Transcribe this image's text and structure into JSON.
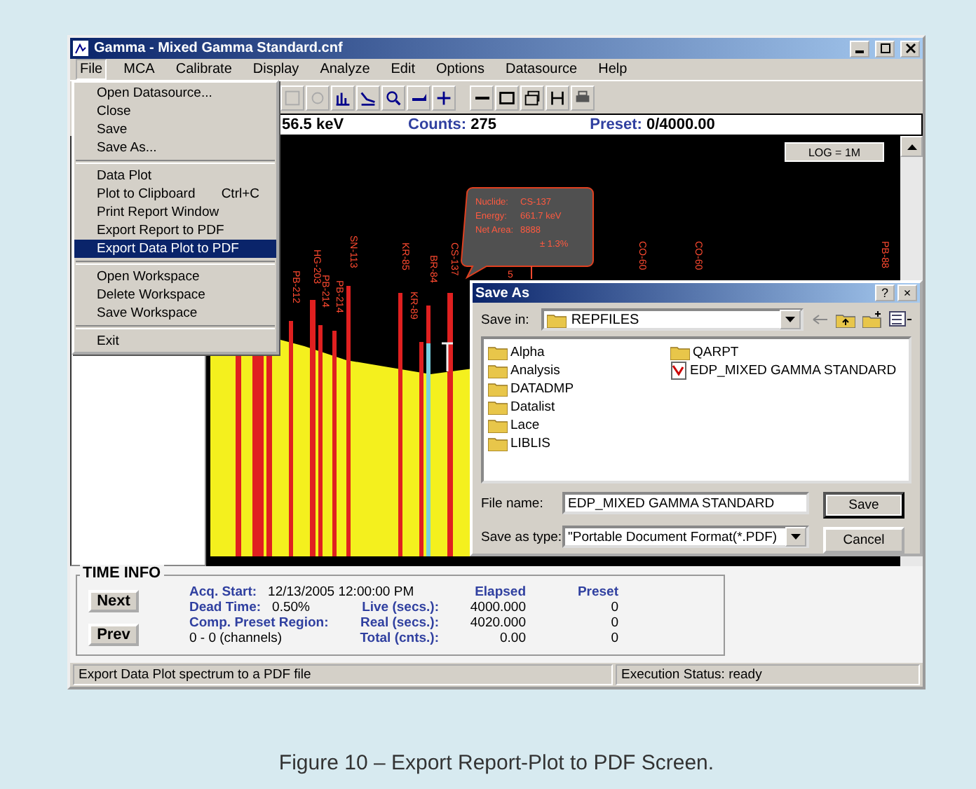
{
  "window": {
    "title": "Gamma - Mixed Gamma Standard.cnf"
  },
  "menu_bar": [
    {
      "label": "File",
      "selected": true
    },
    {
      "label": "MCA",
      "selected": false
    },
    {
      "label": "Calibrate",
      "selected": false
    },
    {
      "label": "Display",
      "selected": false
    },
    {
      "label": "Analyze",
      "selected": false
    },
    {
      "label": "Edit",
      "selected": false
    },
    {
      "label": "Options",
      "selected": false
    },
    {
      "label": "Datasource",
      "selected": false
    },
    {
      "label": "Help",
      "selected": false
    }
  ],
  "file_menu": [
    [
      {
        "label": "Open Datasource...",
        "selected": false
      },
      {
        "label": "Close",
        "selected": false
      },
      {
        "label": "Save",
        "selected": false
      },
      {
        "label": "Save As...",
        "selected": false
      }
    ],
    [
      {
        "label": "Data Plot",
        "selected": false
      },
      {
        "label": "Plot to Clipboard",
        "shortcut": "Ctrl+C",
        "selected": false
      },
      {
        "label": "Print Report Window",
        "selected": false
      },
      {
        "label": "Export Report to PDF",
        "selected": false
      },
      {
        "label": "Export Data Plot to PDF",
        "selected": true
      }
    ],
    [
      {
        "label": "Open Workspace",
        "selected": false
      },
      {
        "label": "Delete Workspace",
        "selected": false
      },
      {
        "label": "Save Workspace",
        "selected": false
      }
    ],
    [
      {
        "label": "Exit",
        "selected": false
      }
    ]
  ],
  "readout": {
    "energy": "56.5 keV",
    "counts_label": "Counts:",
    "counts": "275",
    "preset_label": "Preset:",
    "preset": "0/4000.00"
  },
  "spectrum": {
    "scale": "LOG = 1M",
    "cursor_label": "5",
    "peak_labels": [
      {
        "text": "PB-212"
      },
      {
        "text": "HG-203"
      },
      {
        "text": "PB-214"
      },
      {
        "text": "PB-214"
      },
      {
        "text": "SN-113"
      },
      {
        "text": "KR-85"
      },
      {
        "text": "KR-89"
      },
      {
        "text": "BR-84"
      },
      {
        "text": "CS-137"
      },
      {
        "text": "CO-60"
      },
      {
        "text": "CO-60"
      },
      {
        "text": "PB-88"
      }
    ],
    "tooltip": [
      {
        "label": "Nuclide:",
        "value": "CS-137"
      },
      {
        "label": "Energy:",
        "value": "661.7 keV"
      },
      {
        "label": "Net Area:",
        "value": "8888"
      },
      {
        "value": "± 1.3%"
      }
    ]
  },
  "time_info": {
    "title": "TIME INFO",
    "buttons": [
      "Next",
      "Prev"
    ],
    "left_rows": [
      {
        "label": "Acq. Start:",
        "value": "12/13/2005 12:00:00 PM"
      },
      {
        "label": "Dead Time:",
        "value": "0.50%"
      },
      {
        "label": "Comp. Preset Region:"
      },
      {
        "value": "0 - 0 (channels)"
      }
    ],
    "columns": [
      "Elapsed",
      "Preset"
    ],
    "counters": [
      {
        "label": "Live (secs.):",
        "elapsed": "4000.000",
        "preset": "0"
      },
      {
        "label": "Real (secs.):",
        "elapsed": "4020.000",
        "preset": "0"
      },
      {
        "label": "Total (cnts.):",
        "elapsed": "0.00",
        "preset": "0"
      }
    ]
  },
  "status_bar": [
    "Export Data Plot spectrum to a PDF file",
    "Execution Status: ready"
  ],
  "save_as": {
    "title": "Save As",
    "help": "?",
    "close": "×",
    "save_in_label": "Save in:",
    "save_in": "REPFILES",
    "files": [
      {
        "name": "Alpha",
        "kind": "folder"
      },
      {
        "name": "Analysis",
        "kind": "folder"
      },
      {
        "name": "DATADMP",
        "kind": "folder"
      },
      {
        "name": "Datalist",
        "kind": "folder"
      },
      {
        "name": "Lace",
        "kind": "folder"
      },
      {
        "name": "LIBLIS",
        "kind": "folder"
      },
      {
        "name": "QARPT",
        "kind": "folder"
      },
      {
        "name": "EDP_MIXED GAMMA STANDARD",
        "kind": "pdf"
      }
    ],
    "file_name_label": "File name:",
    "file_name": "EDP_MIXED GAMMA STANDARD",
    "type_label": "Save as type:",
    "type": "\"Portable Document Format(*.PDF)",
    "buttons": [
      "Save",
      "Cancel"
    ]
  },
  "caption": "Figure 10 – Export Report-Plot to PDF Screen."
}
